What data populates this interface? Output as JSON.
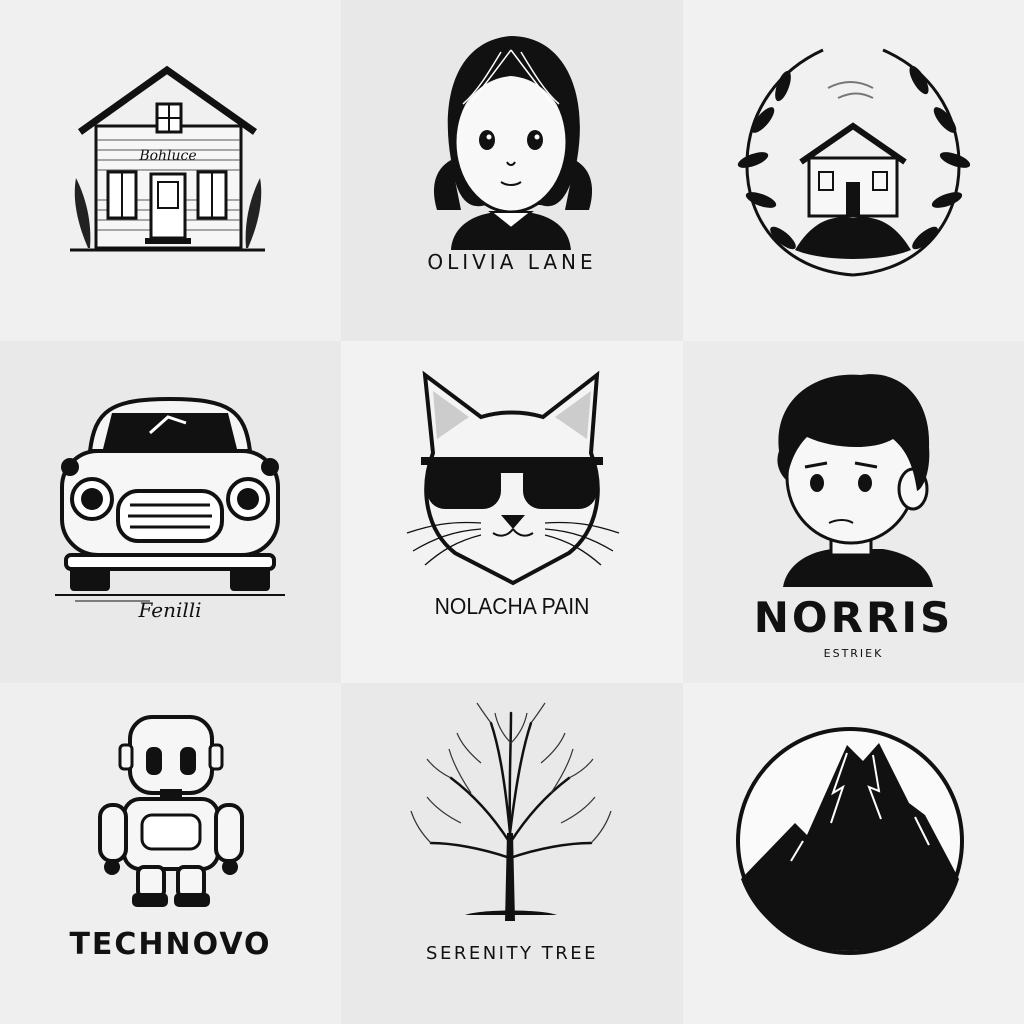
{
  "background": "#ececec",
  "tile_colors": [
    "#f0f0f0",
    "#e8e8e8",
    "#f1f1f1",
    "#e9e9e9",
    "#f2f2f2",
    "#ebebeb",
    "#efefef",
    "#e9e9e9",
    "#f1f1f1"
  ],
  "logos": {
    "house": {
      "sign_text": "Bohluce",
      "icon": "house-icon"
    },
    "girl": {
      "name": "OLIVIA LANE",
      "icon": "girl-portrait-icon"
    },
    "wreath_house": {
      "icon": "house-wreath-icon"
    },
    "car": {
      "signature": "Fenilli",
      "icon": "car-icon"
    },
    "cat": {
      "name": "NOLACHA PAIN",
      "icon": "cat-sunglasses-icon"
    },
    "boy": {
      "name": "NORRIS",
      "tagline": "ESTRIEK",
      "icon": "boy-portrait-icon"
    },
    "robot": {
      "name": "TECHNOVO",
      "icon": "robot-icon"
    },
    "tree": {
      "name": "SERENITY TREE",
      "icon": "tree-icon"
    },
    "mountain": {
      "icon": "mountain-icon"
    }
  }
}
